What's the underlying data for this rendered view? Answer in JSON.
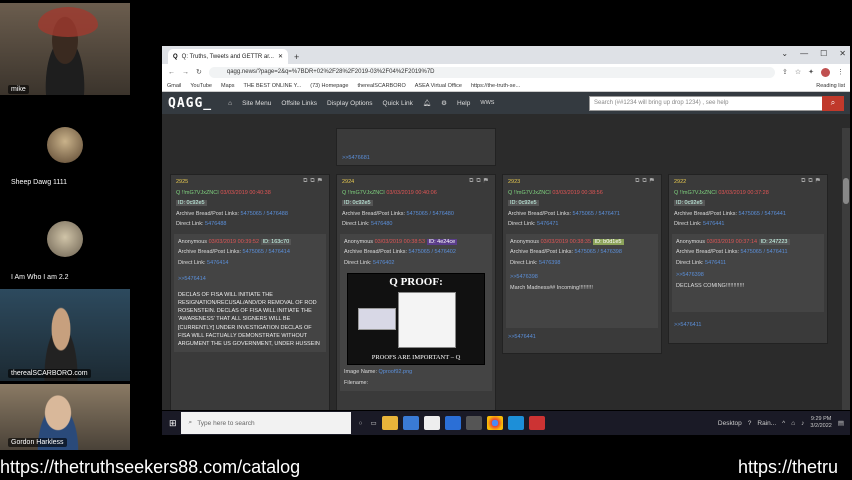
{
  "participants": [
    {
      "name": "mike"
    },
    {
      "name": "Sheep Dawg 1111"
    },
    {
      "name": "I Am Who I am 2.2"
    },
    {
      "name": "therealSCARBORO.com"
    },
    {
      "name": "Gordon Harkless"
    }
  ],
  "browser": {
    "tab_title": "Q: Truths, Tweets and GETTR ar...",
    "url": "qagg.news/?page=2&q=%7BDR+02%2F28%2F2019-03%2F04%2F2019%7D",
    "bookmarks": [
      "Gmail",
      "YouTube",
      "Maps",
      "THE BEST ONLINE Y...",
      "(73) Homepage",
      "therealSCARBORO",
      "ASEA Virtual Office",
      "https://the-truth-se..."
    ],
    "reading_list": "Reading list"
  },
  "site": {
    "logo": "QAGG_",
    "menus": [
      "Site Menu",
      "Offsite Links",
      "Display Options",
      "Quick Link"
    ],
    "help": "Help",
    "wws": "WWS",
    "search_placeholder": "Search  (##1234 will bring up drop 1234) , see help"
  },
  "top_card": {
    "link": ">>5476681"
  },
  "cards": [
    {
      "num": "2925",
      "author": "Q !!mG7VJxZNCI",
      "date": "03/03/2019 00:40:38",
      "id": "ID: 0c92e5",
      "archive": "Archive Bread/Post Links:",
      "archive_links": "5475065 / 5476488",
      "direct": "Direct Link:",
      "direct_link": "5476488",
      "reply_author": "Anonymous",
      "reply_date": "03/03/2019 00:39:52",
      "reply_id": "ID: 163c70",
      "reply_archive": "5475065 / 5476414",
      "reply_direct": "5476414",
      "quote": ">>5476414",
      "body": "DECLAS OF FISA WILL INITIATE THE RESIGNATION/RECUSAL/AND/OR REMOVAL OF ROD ROSENSTEIN. DECLAS OF FISA WILL INITIATE THE 'AWARENESS' THAT ALL SIGNERS WILL BE [CURRENTLY] UNDER INVESTIGATION DECLAS OF FISA WILL FACTUALLY DEMONSTRATE WITHOUT ARGUMENT THE US GOVERNMENT, UNDER HUSSEIN"
    },
    {
      "num": "2924",
      "author": "Q !!mG7VJxZNCI",
      "date": "03/03/2019 00:40:06",
      "id": "ID: 0c92e5",
      "archive": "Archive Bread/Post Links:",
      "archive_links": "5475065 / 5476480",
      "direct": "Direct Link:",
      "direct_link": "5476480",
      "reply_author": "Anonymous",
      "reply_date": "03/03/2019 00:38:53",
      "reply_id": "ID: 4e24ce",
      "reply_archive": "5475065 / 5476402",
      "reply_direct": "5476402",
      "image_title": "Q PROOF:",
      "image_caption": "PROOFS ARE IMPORTANT – Q",
      "image_name_label": "Image Name:",
      "image_name": "Qproof92.png",
      "filename_label": "Filename:"
    },
    {
      "num": "2923",
      "author": "Q !!mG7VJxZNCI",
      "date": "03/03/2019 00:38:56",
      "id": "ID: 0c92e5",
      "archive": "Archive Bread/Post Links:",
      "archive_links": "5475065 / 5476471",
      "direct": "Direct Link:",
      "direct_link": "5476471",
      "reply_author": "Anonymous",
      "reply_date": "03/03/2019 00:38:35",
      "reply_id": "ID: b0d1e5",
      "reply_archive": "5475065 / 5476398",
      "reply_direct": "5476398",
      "quote": ">>5476398",
      "body": "March Madness## Incoming!!!!!!!!!",
      "footer": ">>5476441"
    },
    {
      "num": "2922",
      "author": "Q !!mG7VJxZNCI",
      "date": "03/03/2019 00:37:28",
      "id": "ID: 0c92e5",
      "archive": "Archive Bread/Post Links:",
      "archive_links": "5475065 / 5476441",
      "direct": "Direct Link:",
      "direct_link": "5476441",
      "reply_author": "Anonymous",
      "reply_date": "03/03/2019 00:37:14",
      "reply_id": "ID: 247223",
      "reply_archive": "5475065 / 5476411",
      "reply_direct": "5476411",
      "quote": ">>5476398",
      "body": "DECLASS COMING!!!!!!!!!!!!",
      "footer": ">>5476411"
    }
  ],
  "taskbar": {
    "search_placeholder": "Type here to search",
    "desktop": "Desktop",
    "weather": "Rain...",
    "time": "9:29 PM",
    "date": "3/2/2022"
  },
  "ticker": {
    "text1": "https://thetruthseekers88.com/catalog",
    "text2": "https://thetru"
  }
}
